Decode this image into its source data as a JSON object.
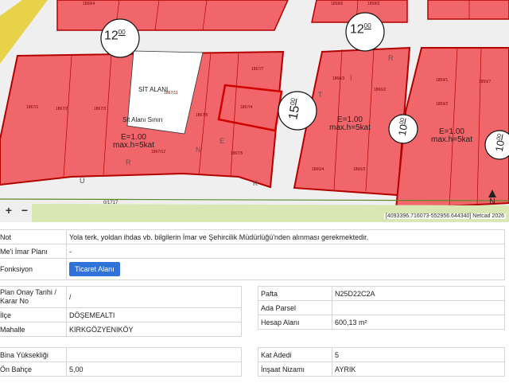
{
  "map": {
    "road_labels": [
      "12",
      "00",
      "12",
      "00",
      "15",
      "00",
      "10",
      "00",
      "10",
      "00"
    ],
    "zone_labels": [
      {
        "e": "E=1.00",
        "h": "max.h=5kat"
      },
      {
        "e": "E=1.00",
        "h": "max.h=5kat"
      },
      {
        "e": "E=1.00",
        "h": "max.h=5kat"
      }
    ],
    "sit_label": "SİT ALANI",
    "sit_label2": "Sit Alanı Sınırı",
    "street_letters": [
      "Ü",
      "R",
      "N",
      "E",
      "K",
      "T",
      "İ",
      "R"
    ],
    "parcel_ids": [
      "1867/1",
      "1867/2",
      "1867/3",
      "1867/11",
      "1867/6",
      "1867/4",
      "1867/7",
      "1867/5",
      "1867/12",
      "1866/3",
      "1866/2",
      "1866/4",
      "1866/3",
      "1859/1",
      "1859/2",
      "1859/7",
      "1858/6",
      "1858/3",
      "1868/4",
      "0/1717"
    ],
    "zoom_in": "+",
    "zoom_out": "−",
    "attribution": "[4093396.716073-552956.644340] Netcad 2026",
    "compass": "N",
    "colors": {
      "parcel": "#f0666b",
      "parcel_stroke": "#b30000",
      "road": "#eeeeee",
      "green": "#d9e7b5",
      "yellow": "#e8d24a"
    }
  },
  "info1": {
    "rows": [
      {
        "key": "Not",
        "value": "Yola terk, yoldan ihdas vb. bilgilerin İmar ve Şehircilik Müdürlüğü'nden alınması gerekmektedir."
      },
      {
        "key": "Me'i İmar Planı",
        "value": "-"
      },
      {
        "key": "Fonksiyon",
        "button": "Ticaret Alanı"
      }
    ]
  },
  "info2": {
    "rows": [
      {
        "key": "Plan Onay Tarihi / Karar No",
        "value": "/"
      },
      {
        "key": "İlçe",
        "value": "DÖŞEMEALTI"
      },
      {
        "key": "Mahalle",
        "value": "KIRKGÖZYENIKÖY"
      }
    ]
  },
  "info3": {
    "rows": [
      {
        "key": "Pafta",
        "value": "N25D22C2A"
      },
      {
        "key": "Ada Parsel",
        "value": ""
      },
      {
        "key": "Hesap Alanı",
        "value": "600,13 m²"
      }
    ]
  },
  "info4": {
    "rows": [
      {
        "key": "Bina Yüksekliği",
        "value": ""
      },
      {
        "key": "Ön Bahçe",
        "value": "5,00"
      }
    ]
  },
  "info5": {
    "rows": [
      {
        "key": "Kat Adedi",
        "value": "5"
      },
      {
        "key": "İnşaat Nizamı",
        "value": "AYRIK"
      }
    ]
  }
}
